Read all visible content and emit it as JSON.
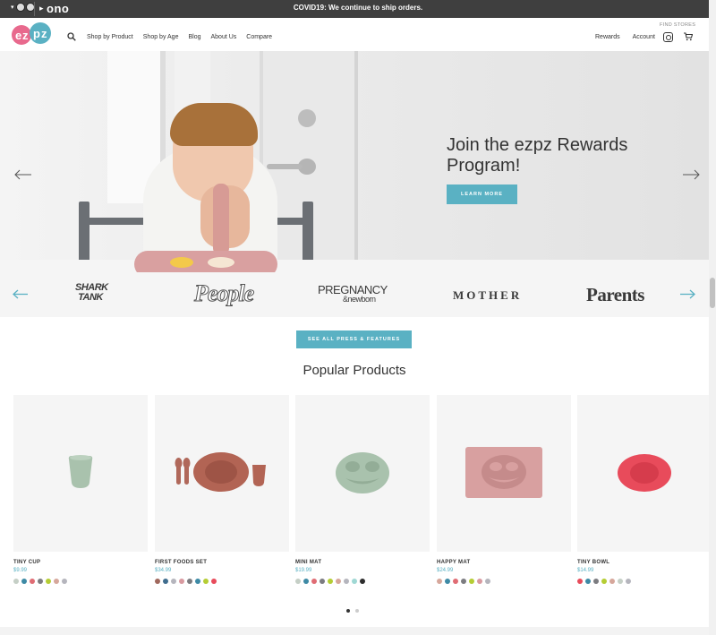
{
  "topbar": {
    "brand": "ono",
    "announcement": "COVID19: We continue to ship orders."
  },
  "header": {
    "logo_text": "ezpz",
    "nav": [
      "Shop by Product",
      "Shop by Age",
      "Blog",
      "About Us",
      "Compare"
    ],
    "find_stores": "FIND STORES",
    "rewards": "Rewards",
    "account": "Account"
  },
  "hero": {
    "headline": "Join the ezpz Rewards Program!",
    "cta": "LEARN MORE"
  },
  "press": {
    "logos": [
      "SHARK TANK",
      "People",
      "PREGNANCY",
      "&newborn",
      "MOTHER",
      "Parents"
    ],
    "cta": "SEE ALL PRESS & FEATURES"
  },
  "popular": {
    "title": "Popular Products",
    "products": [
      {
        "name": "TINY CUP",
        "price": "$9.99",
        "swatches": [
          "#c5cfc6",
          "#3e8aa5",
          "#e06c74",
          "#7c7c80",
          "#b5cd34",
          "#d6a79b",
          "#b5b5bd"
        ]
      },
      {
        "name": "FIRST FOODS SET",
        "price": "$34.99",
        "swatches": [
          "#a0685d",
          "#3f6d8e",
          "#b5b5bd",
          "#d99aa0",
          "#7c7c80",
          "#3e8aa5",
          "#b5cd34",
          "#e84b5b"
        ]
      },
      {
        "name": "MINI MAT",
        "price": "$19.99",
        "swatches": [
          "#c5cfc6",
          "#3e8aa5",
          "#e06c74",
          "#7c7c80",
          "#b5cd34",
          "#d6a79b",
          "#b5b5bd",
          "#9fd8d4",
          "#2d2d2d"
        ]
      },
      {
        "name": "HAPPY MAT",
        "price": "$24.99",
        "swatches": [
          "#d6a79b",
          "#3e8aa5",
          "#e06c74",
          "#7c7c80",
          "#b5cd34",
          "#d99aa0",
          "#b5b5bd"
        ]
      },
      {
        "name": "TINY BOWL",
        "price": "$14.99",
        "swatches": [
          "#e84b5b",
          "#3e8aa5",
          "#7c7c80",
          "#b5cd34",
          "#d6a79b",
          "#c5cfc6",
          "#b5b5bd"
        ]
      }
    ]
  },
  "colors": {
    "accent": "#5ab1c3",
    "topbar": "#3f3f3f"
  }
}
